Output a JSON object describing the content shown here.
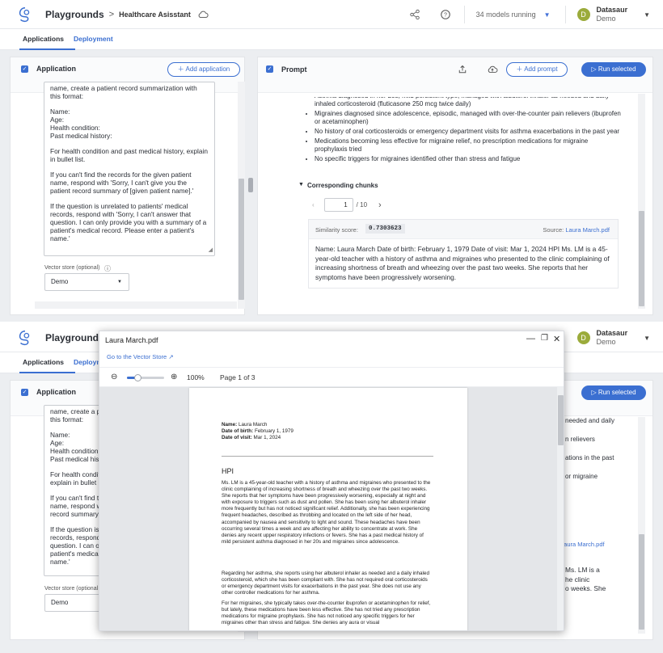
{
  "app": {
    "breadcrumb_root": "Playgrounds",
    "breadcrumb_sep": ">",
    "breadcrumb_current": "Healthcare Asisstant",
    "models_running": "34 models running",
    "user_initial": "D",
    "user_name": "Datasaur",
    "user_org": "Demo"
  },
  "tabs": [
    {
      "label": "Applications",
      "active": true
    },
    {
      "label": "Deployment",
      "active": false
    }
  ],
  "application_panel": {
    "title": "Application",
    "add_button": "Add application",
    "prompt_paragraphs": [
      "name, create a patient record summarization with this format:",
      "Name:\nAge:\nHealth condition:\nPast medical history:",
      "For health condition and past medical history, explain in bullet list.",
      "If you can't find the records for the given patient name, respond with 'Sorry, I can't give you the patient record summary of [given patient name].'",
      "If the question is unrelated to patients' medical records, respond with 'Sorry, I can't answer that question. I can only provide you with a summary of a patient's medical record. Please enter a patient's name.'"
    ],
    "vector_store_label": "Vector store (optional)",
    "vector_store_value": "Demo"
  },
  "prompt_panel": {
    "title": "Prompt",
    "add_button": "Add prompt",
    "run_button": "Run selected",
    "bullets": [
      "Asthma diagnosed in her 20s, mild persistent type, managed with albuterol inhaler as needed and daily inhaled corticosteroid (fluticasone 250 mcg twice daily)",
      "Migraines diagnosed since adolescence, episodic, managed with over-the-counter pain relievers (ibuprofen or acetaminophen)",
      "No history of oral corticosteroids or emergency department visits for asthma exacerbations in the past year",
      "Medications becoming less effective for migraine relief, no prescription medications for migraine prophylaxis tried",
      "No specific triggers for migraines identified other than stress and fatigue"
    ],
    "chunks_header": "Corresponding chunks",
    "page_current": "1",
    "page_total": "/ 10",
    "similarity_label": "Similarity score:",
    "similarity_value": "0.7303623",
    "source_label": "Source:",
    "source_file": "Laura March.pdf",
    "chunk_text": "Name: Laura March Date of birth: February 1, 1979 Date of visit: Mar 1, 2024 HPI Ms. LM is a 45-year-old teacher with a history of asthma and migraines who presented to the clinic complaining of increasing shortness of breath and wheezing over the past two weeks. She reports that her symptoms have been progressively worsening."
  },
  "behind_fragments": {
    "prompt_lines": [
      "name, create a pa",
      "this format:",
      "Name:",
      "Age:",
      "Health condition",
      "Past medical histo",
      "For health conditi",
      "explain in bullet l",
      "If you can't find t",
      "name, respond w",
      "record summary",
      "If the question is",
      "records, respond",
      "question. I can o",
      "patient's medical",
      "name.'"
    ],
    "vector_store_label": "Vector store (optional",
    "right_fragments": [
      "needed and daily",
      "n relievers",
      "ations in the past",
      "or migraine",
      "Laura March.pdf",
      "Ms. LM is a",
      "he clinic",
      "o weeks. She"
    ]
  },
  "pdf_viewer": {
    "title": "Laura March.pdf",
    "link": "Go to the Vector Store",
    "zoom": "100%",
    "page_info": "Page 1 of 3",
    "name_label": "Name:",
    "name_value": "Laura March",
    "dob_label": "Date of birth:",
    "dob_value": "February 1, 1979",
    "visit_label": "Date of visit:",
    "visit_value": "Mar 1, 2024",
    "heading": "HPI",
    "para1": "Ms. LM is a 45-year-old teacher with a history of asthma and migraines who presented to the clinic complaining of increasing shortness of breath and wheezing over the past two weeks. She reports that her symptoms have been progressively worsening, especially at night and with exposure to triggers such as dust and pollen. She has been using her albuterol inhaler more frequently but has not noticed significant relief. Additionally, she has been experiencing frequent headaches, described as throbbing and located on the left side of her head, accompanied by nausea and sensitivity to light and sound. These headaches have been occurring several times a week and are affecting her ability to concentrate at work. She denies any recent upper respiratory infections or fevers. She has a past medical history of mild persistent asthma diagnosed in her 20s and migraines since adolescence.",
    "para2": "Regarding her asthma, she reports using her albuterol inhaler as needed and a daily inhaled corticosteroid, which she has been compliant with. She has not required oral corticosteroids or emergency department visits for exacerbations in the past year. She does not use any other controller medications for her asthma.",
    "para3": "For her migraines, she typically takes over-the-counter ibuprofen or acetaminophen for relief, but lately, these medications have been less effective. She has not tried any prescription medications for migraine prophylaxis. She has not noticed any specific triggers for her migraines other than stress and fatigue. She denies any aura or visual"
  },
  "colors": {
    "accent": "#3b6fd1",
    "avatar": "#9bab3b",
    "workarea": "#eceef1"
  }
}
